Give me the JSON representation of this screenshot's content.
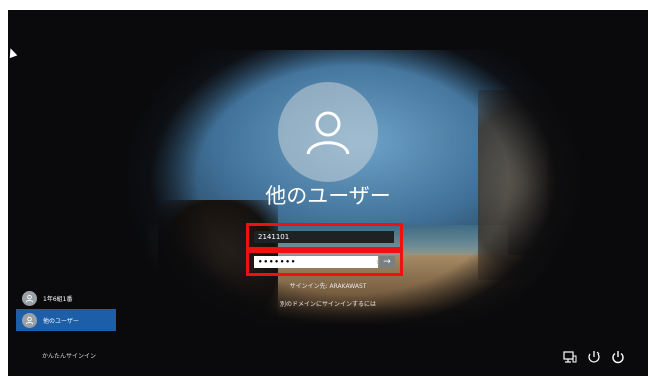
{
  "login": {
    "user_name": "他のユーザー",
    "username_value": "2141101",
    "password_masked": "•••••••",
    "submit_glyph": "→",
    "sign_in_to": "サインイン先: ARAKAWAST",
    "other_domain_link": "別のドメインにサインインするには"
  },
  "users": [
    {
      "label": "1年6組1番",
      "selected": false
    },
    {
      "label": "他のユーザー",
      "selected": true
    }
  ],
  "easy_signin": "かんたんサインイン",
  "icons": {
    "network": "network-icon",
    "accessibility": "accessibility-icon",
    "power": "power-icon"
  },
  "colors": {
    "highlight": "#ee1111",
    "selected_user": "#1c5fa8"
  }
}
